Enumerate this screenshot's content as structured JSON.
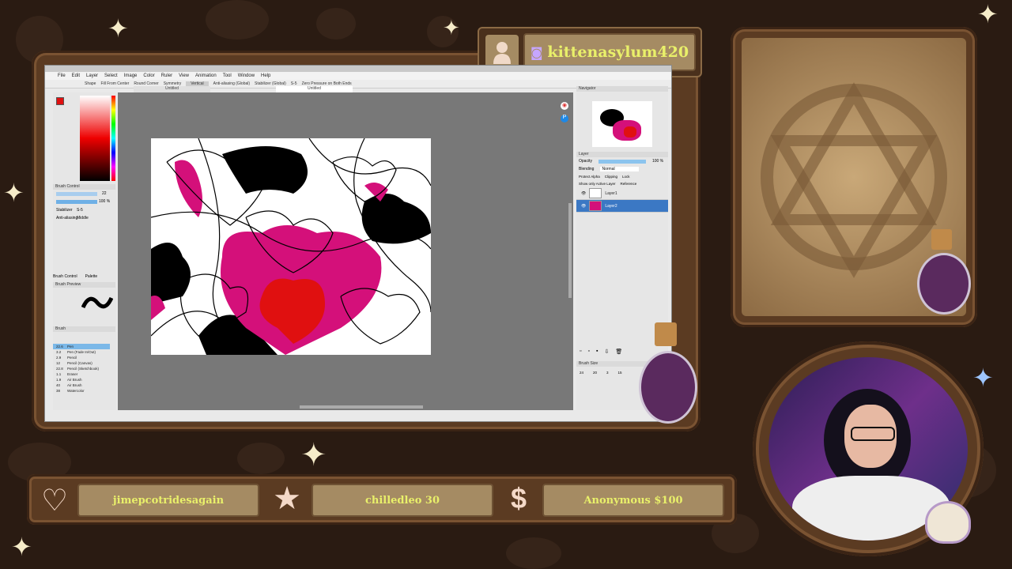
{
  "overlay": {
    "twitch_username": "kittenasylum420",
    "latest_follower": "jimepcotridesagain",
    "latest_subscriber": "chilledleo 30",
    "latest_donation": "Anonymous $100",
    "colors": {
      "background": "#2a1b12",
      "frame": "#5b3b22",
      "text_accent": "#e9f06a",
      "magenta": "#d4107a",
      "red": "#e01010"
    }
  },
  "app": {
    "menu": [
      "File",
      "Edit",
      "Layer",
      "Select",
      "Image",
      "Color",
      "Ruler",
      "View",
      "Animation",
      "Tool",
      "Window",
      "Help"
    ],
    "toolbar": {
      "shape_label": "Shape",
      "from_center": "Fill From Center",
      "round_corner": "Round Corner",
      "symmetry_label": "Symmetry",
      "symmetry_value": "Vertical",
      "antialias_label": "Anti-aliasing (Global)",
      "stabilizer_label": "Stabilizer (Global)",
      "stabilizer_value": "S-5",
      "zero_pressure": "Zero Pressure on Both Ends"
    },
    "tabs": [
      "Untitled",
      "Untitled"
    ],
    "brush_control": {
      "title": "Brush Control",
      "stabilizer_label": "Stabilizer",
      "stabilizer_value": "S-5",
      "antialias_label": "Anti-aliasing",
      "antialias_value": "Middle",
      "size_value": "22",
      "opacity_value": "100 %"
    },
    "panel_tabs": [
      "Brush Control",
      "Palette"
    ],
    "brush_preview_title": "Brush Preview",
    "brush_title": "Brush",
    "brushes": [
      {
        "size": "22.6",
        "name": "Pen",
        "selected": true
      },
      {
        "size": "3.2",
        "name": "Pen (Fade In/Out)"
      },
      {
        "size": "2.9",
        "name": "Pencil"
      },
      {
        "size": "12",
        "name": "Pencil (Canvas)"
      },
      {
        "size": "22.8",
        "name": "Pencil (Sketchbook)"
      },
      {
        "size": "1.1",
        "name": "Eraser"
      },
      {
        "size": "1.9",
        "name": "Air Brush"
      },
      {
        "size": "40",
        "name": "Air Brush"
      },
      {
        "size": "38",
        "name": "Watercolor"
      }
    ],
    "navigator_title": "Navigator",
    "layer_panel": {
      "title": "Layer",
      "opacity_label": "Opacity",
      "opacity_value": "100 %",
      "blending_label": "Blending",
      "blending_value": "Normal",
      "protect_alpha": "Protect Alpha",
      "clipping": "Clipping",
      "lock": "Lock",
      "show_active": "Show only Active Layer",
      "reference": "Reference"
    },
    "layers": [
      {
        "name": "Layer1",
        "selected": false
      },
      {
        "name": "Layer2",
        "selected": true
      }
    ],
    "brush_size_title": "Brush Size",
    "brush_sizes": [
      "24",
      "20",
      "3",
      "15"
    ]
  }
}
